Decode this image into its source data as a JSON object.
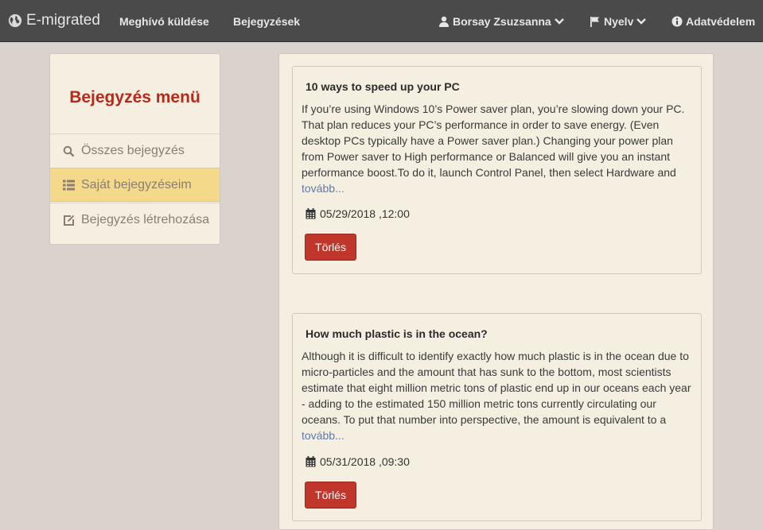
{
  "navbar": {
    "brand": "E-migrated",
    "invite": "Meghívó küldése",
    "posts": "Bejegyzések",
    "user": "Borsay Zsuzsanna",
    "language": "Nyelv",
    "privacy": "Adatvédelem",
    "icons": [
      "globe-icon",
      "user-icon",
      "chevron-down-icon",
      "flag-icon",
      "info-icon"
    ]
  },
  "sidebar": {
    "title": "Bejegyzés menü",
    "items": [
      {
        "label": "Összes bejegyzés",
        "icon": "search-icon"
      },
      {
        "label": "Saját bejegyzéseim",
        "icon": "list-icon",
        "active": true
      },
      {
        "label": "Bejegyzés létrehozása",
        "icon": "edit-icon"
      }
    ]
  },
  "posts": [
    {
      "title": "10 ways to speed up your PC",
      "body": "If you’re using Windows 10’s Power saver plan, you’re slowing down your PC. That plan reduces your PC’s performance in order to save energy. (Even desktop PCs typically have a Power saver plan.) Changing your power plan from Power saver to High performance or Balanced will give you an instant performance boost.To do it, launch Control Panel, then select Hardware and",
      "more": "tovább...",
      "date": "05/29/2018 ,12:00",
      "delete": "Törlés"
    },
    {
      "title": "How much plastic is in the ocean?",
      "body": "Although it is difficult to identify exactly how much plastic is in the ocean due to micro-particles and the amount that has sunk to the bottom, most scientists estimate that eight million metric tons of plastic end up in our oceans each year - adding to the estimated 150 million metric tons currently circulating our oceans. To put that number into perspective, the amount is equivalent to a",
      "more": "tovább...",
      "date": "05/31/2018 ,09:30",
      "delete": "Törlés"
    }
  ],
  "colors": {
    "navbar_bg": "#4a4a4a",
    "page_bg": "#d9d2cd",
    "panel_bg": "#f5efe2",
    "accent_title": "#b52a1b",
    "active_item": "#f4d98a",
    "delete_button": "#c0362a"
  }
}
